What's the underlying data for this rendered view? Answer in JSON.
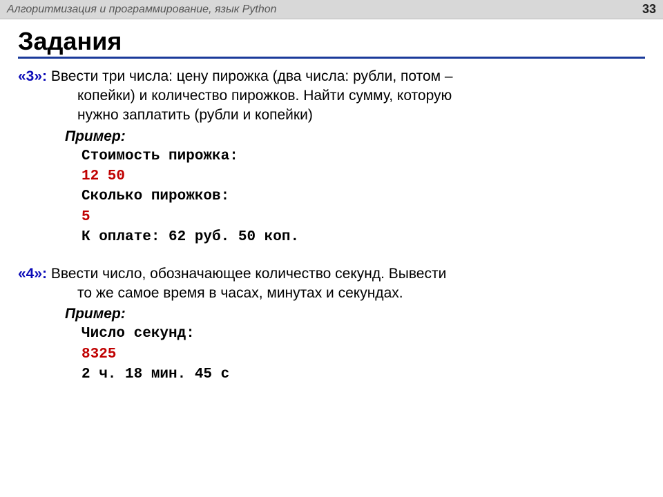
{
  "header": {
    "title": "Алгоритмизация и программирование, язык Python",
    "page_number": "33"
  },
  "heading": "Задания",
  "task1": {
    "label": "«3»:",
    "text_line1": " Ввести три числа: цену пирожка (два числа: рубли, потом –",
    "text_line2": "копейки) и количество пирожков. Найти сумму, которую",
    "text_line3": "нужно заплатить (рубли и копейки)",
    "example_label": "Пример:",
    "code": {
      "l1": "Стоимость пирожка:",
      "l2": "12 50",
      "l3": "Сколько пирожков:",
      "l4": "5",
      "l5": "К оплате: 62 руб. 50 коп."
    }
  },
  "task2": {
    "label": "«4»:",
    "text_line1": " Ввести число, обозначающее количество секунд. Вывести",
    "text_line2": "то же самое время в часах, минутах и секундах.",
    "example_label": "Пример:",
    "code": {
      "l1": "Число секунд:",
      "l2": "8325",
      "l3": "2 ч. 18 мин. 45 с"
    }
  }
}
